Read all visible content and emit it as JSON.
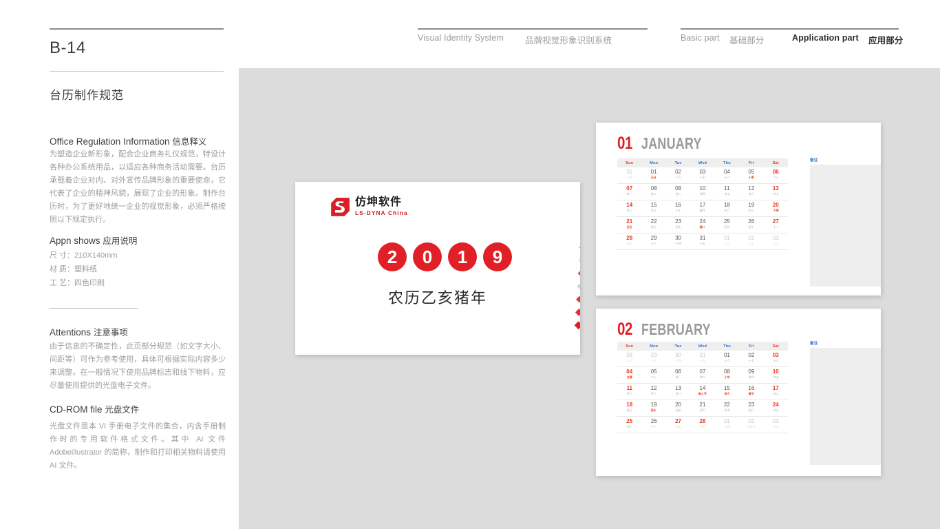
{
  "header": {
    "page_code": "B-14",
    "doc_title": "台历制作规范",
    "vis_en": "Visual Identity System",
    "vis_cn": "品牌视觉形象识别系统",
    "basic_en": "Basic part",
    "basic_cn": "基础部分",
    "application_en": "Application part",
    "application_cn": "应用部分"
  },
  "sections": {
    "office": {
      "head_en": "Office Regulation Information",
      "head_cn": "信息释义",
      "body": "为塑造企业新形象，配合企业商务礼仪规范，特设计各种办公系统用品，以适应各种商务活动需要。台历承载着企业对内、对外宣传品牌形象的重要使命，它代表了企业的精神风貌，展现了企业的形象。制作台历时，为了更好地统一企业的视觉形象，必须严格按照以下规定执行。"
    },
    "appn": {
      "head_en": "Appn shows",
      "head_cn": "应用说明",
      "specs": [
        "尺 寸：210X140mm",
        "材 质：塑料纸",
        "工 艺：四色印刷"
      ]
    },
    "attentions": {
      "head_en": "Attentions",
      "head_cn": "注意事项",
      "body": "由于信息的不确定性，此页部分规范（如文字大小、间距等）可作为参考使用，具体可根据实际内容多少来调整。在一般情况下使用品牌标志和线下物料，应尽量使用提供的光盘电子文件。"
    },
    "cdrom": {
      "head_en": "CD-ROM file",
      "head_cn": "光盘文件",
      "body": "光盘文件是本 VI 手册电子文件的集合，内含手册制作时的专用软件格式文件。其中 AI 文件 Adobeillustrator 的简称，制作和打印相关物料请使用 AI 文件。"
    }
  },
  "cover": {
    "logo_cn": "仿坤软件",
    "logo_en": "LS-DYNA China",
    "year_digits": [
      "2",
      "0",
      "1",
      "9"
    ],
    "lunar_line": "农历乙亥猪年"
  },
  "colors": {
    "brand_red": "#e11f26",
    "holiday_red": "#e8391f",
    "dow_blue": "#2f6fc4",
    "stage_gray": "#dcdcdc",
    "month_name_gray": "#9a9a9a"
  },
  "notes_label": "备注",
  "dow": [
    {
      "label": "Sun",
      "weekend": true
    },
    {
      "label": "Mon",
      "weekend": false
    },
    {
      "label": "Tue",
      "weekend": false
    },
    {
      "label": "Wed",
      "weekend": false
    },
    {
      "label": "Thu",
      "weekend": false
    },
    {
      "label": "Fri",
      "weekend": false
    },
    {
      "label": "Sat",
      "weekend": true
    }
  ],
  "months": [
    {
      "num": "01",
      "name": "JANUARY",
      "weeks": [
        [
          {
            "d": "31",
            "l": "十四",
            "out": true
          },
          {
            "d": "01",
            "l": "元旦",
            "ev": true
          },
          {
            "d": "02",
            "l": "十六"
          },
          {
            "d": "03",
            "l": "十七"
          },
          {
            "d": "04",
            "l": "十八"
          },
          {
            "d": "05",
            "l": "小寒",
            "ev": true
          },
          {
            "d": "06",
            "l": "二十",
            "hol": true
          }
        ],
        [
          {
            "d": "07",
            "l": "廿一",
            "hol": true
          },
          {
            "d": "08",
            "l": "廿二"
          },
          {
            "d": "09",
            "l": "廿三"
          },
          {
            "d": "10",
            "l": "廿四"
          },
          {
            "d": "11",
            "l": "廿五"
          },
          {
            "d": "12",
            "l": "廿六"
          },
          {
            "d": "13",
            "l": "廿七",
            "hol": true
          }
        ],
        [
          {
            "d": "14",
            "l": "廿八",
            "hol": true
          },
          {
            "d": "15",
            "l": "廿九"
          },
          {
            "d": "16",
            "l": "三十"
          },
          {
            "d": "17",
            "l": "腊月"
          },
          {
            "d": "18",
            "l": "初二"
          },
          {
            "d": "19",
            "l": "初三"
          },
          {
            "d": "20",
            "l": "大寒",
            "hol": true,
            "ev": true
          }
        ],
        [
          {
            "d": "21",
            "l": "初五",
            "hol": true,
            "ev": true
          },
          {
            "d": "22",
            "l": "初六"
          },
          {
            "d": "23",
            "l": "初七"
          },
          {
            "d": "24",
            "l": "腊八",
            "ev": true
          },
          {
            "d": "25",
            "l": "初九"
          },
          {
            "d": "26",
            "l": "初十"
          },
          {
            "d": "27",
            "l": "十一",
            "hol": true
          }
        ],
        [
          {
            "d": "28",
            "l": "十二",
            "hol": true
          },
          {
            "d": "29",
            "l": "十三"
          },
          {
            "d": "30",
            "l": "十四"
          },
          {
            "d": "31",
            "l": "十五"
          },
          {
            "d": "01",
            "l": "十六",
            "out": true
          },
          {
            "d": "02",
            "l": "十七",
            "out": true
          },
          {
            "d": "03",
            "l": "十八",
            "out": true
          }
        ]
      ]
    },
    {
      "num": "02",
      "name": "FEBRUARY",
      "weeks": [
        [
          {
            "d": "28",
            "l": "十二",
            "out": true
          },
          {
            "d": "29",
            "l": "十三",
            "out": true
          },
          {
            "d": "30",
            "l": "十四",
            "out": true
          },
          {
            "d": "31",
            "l": "十五",
            "out": true
          },
          {
            "d": "01",
            "l": "十六"
          },
          {
            "d": "02",
            "l": "十七"
          },
          {
            "d": "03",
            "l": "十八",
            "hol": true
          }
        ],
        [
          {
            "d": "04",
            "l": "立春",
            "hol": true,
            "ev": true
          },
          {
            "d": "05",
            "l": "二十"
          },
          {
            "d": "06",
            "l": "廿一"
          },
          {
            "d": "07",
            "l": "廿二"
          },
          {
            "d": "08",
            "l": "小年",
            "ev": true
          },
          {
            "d": "09",
            "l": "廿四"
          },
          {
            "d": "10",
            "l": "廿五",
            "hol": true
          }
        ],
        [
          {
            "d": "11",
            "l": "廿六",
            "hol": true
          },
          {
            "d": "12",
            "l": "廿七"
          },
          {
            "d": "13",
            "l": "廿八"
          },
          {
            "d": "14",
            "l": "情人节",
            "ev": true
          },
          {
            "d": "15",
            "l": "除夕",
            "ev": true
          },
          {
            "d": "16",
            "l": "春节",
            "ev": true
          },
          {
            "d": "17",
            "l": "初二",
            "hol": true
          }
        ],
        [
          {
            "d": "18",
            "l": "初三",
            "hol": true
          },
          {
            "d": "19",
            "l": "雨水",
            "ev": true
          },
          {
            "d": "20",
            "l": "初五"
          },
          {
            "d": "21",
            "l": "初六"
          },
          {
            "d": "22",
            "l": "初七"
          },
          {
            "d": "23",
            "l": "初八"
          },
          {
            "d": "24",
            "l": "初九",
            "hol": true
          }
        ],
        [
          {
            "d": "25",
            "l": "初十",
            "hol": true
          },
          {
            "d": "26",
            "l": "十一"
          },
          {
            "d": "27",
            "l": "十二",
            "hol": true
          },
          {
            "d": "28",
            "l": "十三",
            "hol": true
          },
          {
            "d": "01",
            "l": "十四",
            "out": true
          },
          {
            "d": "02",
            "l": "元宵节",
            "out": true
          },
          {
            "d": "03",
            "l": "十六",
            "out": true
          }
        ]
      ]
    }
  ]
}
